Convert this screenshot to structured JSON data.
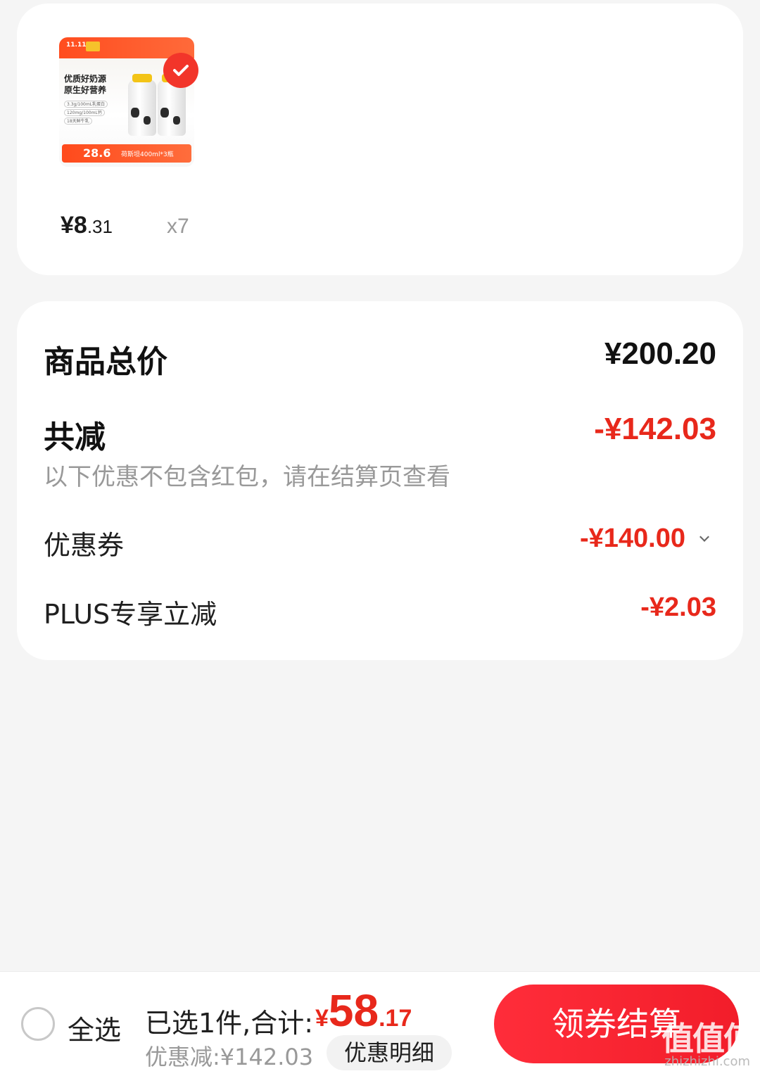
{
  "product": {
    "thumb_logo": "11.11",
    "thumb_title_line1": "优质好奶源",
    "thumb_title_line2": "原生好营养",
    "thumb_tags": [
      "3.3g/100mL乳蛋白",
      "120mg/100mL钙",
      "18天鲜牛乳"
    ],
    "thumb_price": "28.6",
    "thumb_spec": "荷斯坦400ml*3瓶",
    "unit_price_int": "¥8",
    "unit_price_dec": ".31",
    "quantity": "x7",
    "checkbox_icon": "check-icon",
    "badge_color": "#f2352a"
  },
  "summary": {
    "total_label": "商品总价",
    "total_value": "¥200.20",
    "reduce_label": "共减",
    "reduce_value": "-¥142.03",
    "note": "以下优惠不包含红包，请在结算页查看",
    "coupon_label": "优惠券",
    "coupon_value": "-¥140.00",
    "plus_label": "PLUS专享立减",
    "plus_value": "-¥2.03"
  },
  "bottom_bar": {
    "select_all": "全选",
    "selected_text": "已选1件,合计:",
    "total_currency": "¥",
    "total_int": "58",
    "total_dec": ".17",
    "discount_text": "优惠减:¥142.03",
    "detail_button": "优惠明细",
    "checkout_button": "领券结算"
  },
  "watermark": {
    "text": "值值值",
    "domain": "zhizhizhi.com"
  },
  "colors": {
    "accent_red": "#e8281b",
    "checkout_red": "#f21d2a",
    "background": "#f5f5f5"
  }
}
